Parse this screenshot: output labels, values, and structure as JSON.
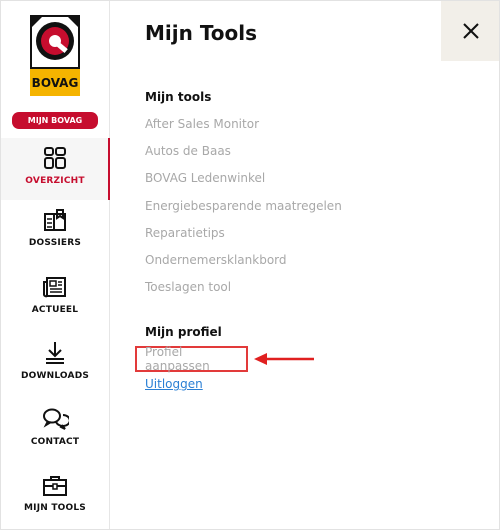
{
  "brand": {
    "logo_text": "BOVAG",
    "badge": "MIJN BOVAG",
    "colors": {
      "red": "#c60d2e",
      "yellow": "#f5b400",
      "link_blue": "#2a7fd4"
    }
  },
  "sidebar": {
    "items": [
      {
        "label": "OVERZICHT",
        "icon": "grid-dashboard-icon",
        "active": true
      },
      {
        "label": "DOSSIERS",
        "icon": "folder-documents-icon"
      },
      {
        "label": "ACTUEEL",
        "icon": "newspaper-icon"
      },
      {
        "label": "DOWNLOADS",
        "icon": "download-icon"
      },
      {
        "label": "CONTACT",
        "icon": "chat-bubbles-icon"
      },
      {
        "label": "MIJN TOOLS",
        "icon": "toolbox-icon"
      }
    ]
  },
  "main": {
    "title": "Mijn Tools",
    "close_icon": "close-icon",
    "tools": {
      "heading": "Mijn tools",
      "items": [
        "After Sales Monitor",
        "Autos de Baas",
        "BOVAG Ledenwinkel",
        "Energiebesparende maatregelen",
        "Reparatietips",
        "Ondernemersklankbord",
        "Toeslagen tool"
      ]
    },
    "profile": {
      "heading": "Mijn profiel",
      "edit_label": "Profiel aanpassen",
      "logout_label": "Uitloggen"
    }
  }
}
